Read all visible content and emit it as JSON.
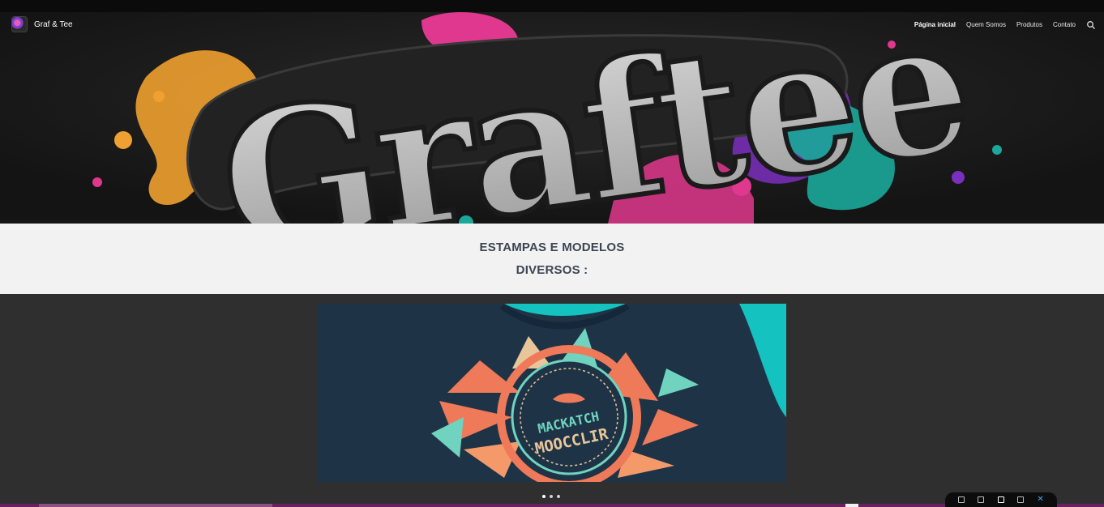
{
  "site": {
    "brand_name": "Graf & Tee"
  },
  "nav": {
    "items": [
      {
        "label": "Página inicial",
        "active": true
      },
      {
        "label": "Quem Somos",
        "active": false
      },
      {
        "label": "Produtos",
        "active": false
      },
      {
        "label": "Contato",
        "active": false
      }
    ]
  },
  "hero": {
    "logo_text": "Graftee"
  },
  "section": {
    "title_line1": "ESTAMPAS E MODELOS",
    "title_line2": "DIVERSOS :"
  },
  "gallery": {
    "slide_text_top": "MACKATCH",
    "slide_text_bottom": "MOOCCLIR",
    "slide_count": 3,
    "active_slide": 1
  },
  "colors": {
    "accent_pink": "#e0388e",
    "accent_purple": "#7b2fbe",
    "accent_teal": "#1aa89a",
    "accent_orange": "#f0a030",
    "slide_bg_teal": "#14c2c0",
    "shirt_navy": "#1e3446",
    "coral": "#ef7a5a"
  }
}
